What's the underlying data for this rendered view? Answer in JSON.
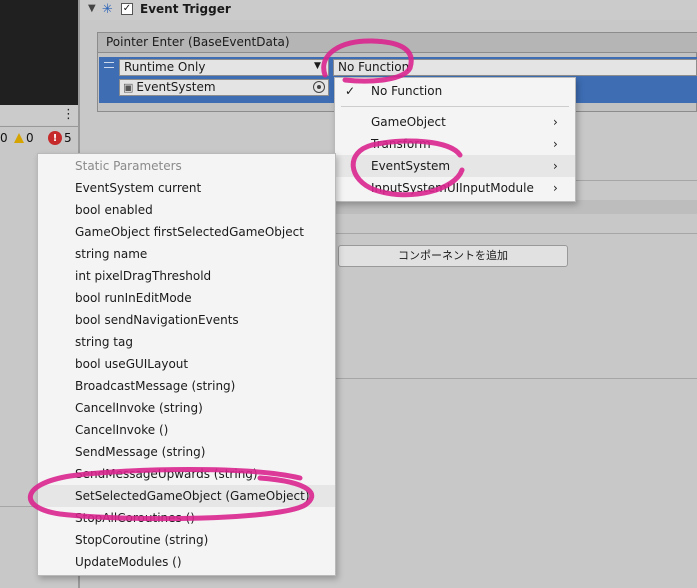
{
  "console": {
    "warn_count": "0",
    "info_count": "0",
    "error_count": "5"
  },
  "component": {
    "title": "Event Trigger"
  },
  "event": {
    "label": "Pointer Enter (BaseEventData)",
    "runtime": "Runtime Only",
    "function": "No Function",
    "target": "EventSystem"
  },
  "add_component_label": "コンポーネントを追加",
  "function_menu": {
    "checked": "No Function",
    "items": [
      "GameObject",
      "Transform",
      "EventSystem",
      "InputSystemUIInputModule"
    ]
  },
  "param_menu": {
    "header": "Static Parameters",
    "items": [
      "EventSystem current",
      "bool enabled",
      "GameObject firstSelectedGameObject",
      "string name",
      "int pixelDragThreshold",
      "bool runInEditMode",
      "bool sendNavigationEvents",
      "string tag",
      "bool useGUILayout",
      "BroadcastMessage (string)",
      "CancelInvoke (string)",
      "CancelInvoke ()",
      "SendMessage (string)",
      "SendMessageUpwards (string)",
      "SetSelectedGameObject (GameObject)",
      "StopAllCoroutines ()",
      "StopCoroutine (string)",
      "UpdateModules ()"
    ]
  },
  "colors": {
    "highlight": "#d9258f",
    "selection": "#3e6db4"
  }
}
